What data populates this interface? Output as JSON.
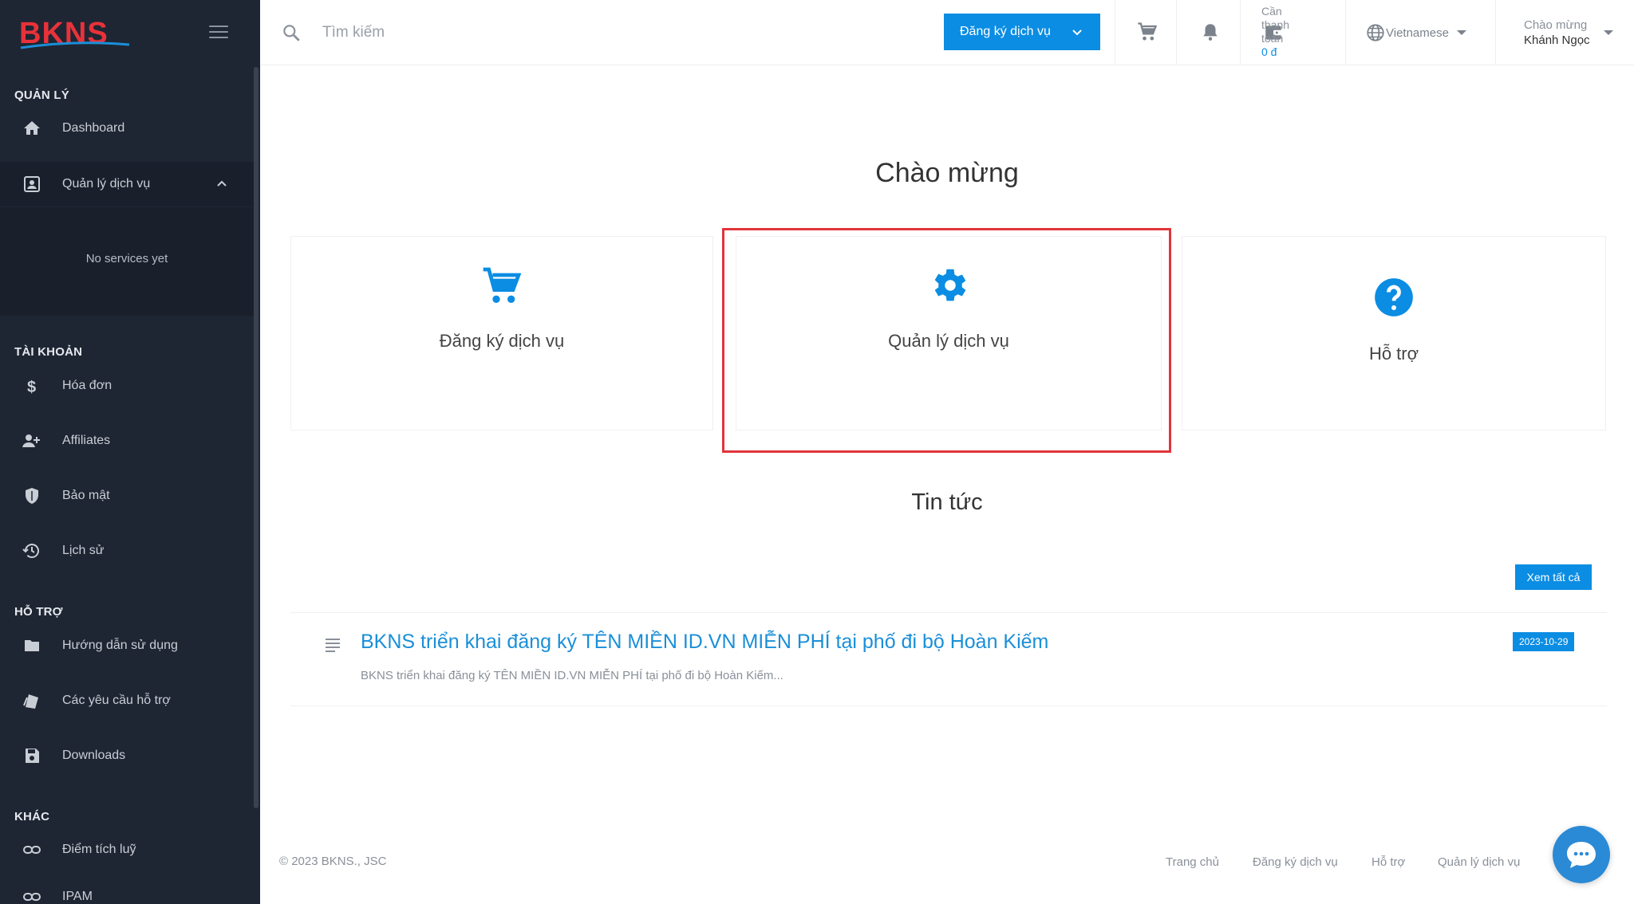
{
  "brand": {
    "logo_text": "BKNS"
  },
  "sidebar": {
    "sections": {
      "manage": "QUẢN LÝ",
      "account": "TÀI KHOẢN",
      "support": "HỖ TRỢ",
      "other": "KHÁC"
    },
    "items": {
      "dashboard": "Dashboard",
      "services": "Quản lý dịch vụ",
      "invoices": "Hóa đơn",
      "affiliates": "Affiliates",
      "security": "Bảo mật",
      "history": "Lịch sử",
      "guide": "Hướng dẫn sử dụng",
      "tickets": "Các yêu cầu hỗ trợ",
      "downloads": "Downloads",
      "points": "Điểm tích luỹ",
      "ipam": "IPAM"
    },
    "services_empty": "No services yet"
  },
  "topbar": {
    "search_placeholder": "Tìm kiếm",
    "register_button": "Đăng ký dịch vụ",
    "payment_label_1": "Cần",
    "payment_label_2": "thanh",
    "payment_label_3": "toán",
    "payment_amount": "0 đ",
    "language": "Vietnamese",
    "greeting": "Chào mừng",
    "username": "Khánh Ngọc"
  },
  "main": {
    "welcome_title": "Chào mừng",
    "cards": {
      "register": "Đăng ký dịch vụ",
      "manage": "Quản lý dịch vụ",
      "support": "Hỗ trợ"
    },
    "news_title": "Tin tức",
    "view_all": "Xem tất cả",
    "news_items": [
      {
        "title": "BKNS triển khai đăng ký TÊN MIỀN ID.VN MIỄN PHÍ tại phố đi bộ Hoàn Kiếm",
        "excerpt": "BKNS triển khai đăng ký TÊN MIỀN ID.VN MIỄN PHÍ tại phố đi bộ Hoàn Kiếm...",
        "date": "2023-10-29"
      }
    ]
  },
  "footer": {
    "copyright": "© 2023 BKNS., JSC",
    "links": [
      "Trang chủ",
      "Đăng ký dịch vụ",
      "Hỗ trợ",
      "Quản lý dịch vụ"
    ]
  },
  "colors": {
    "accent": "#0b8de3",
    "sidebar_bg": "#1f2633",
    "highlight": "#e0353b"
  }
}
